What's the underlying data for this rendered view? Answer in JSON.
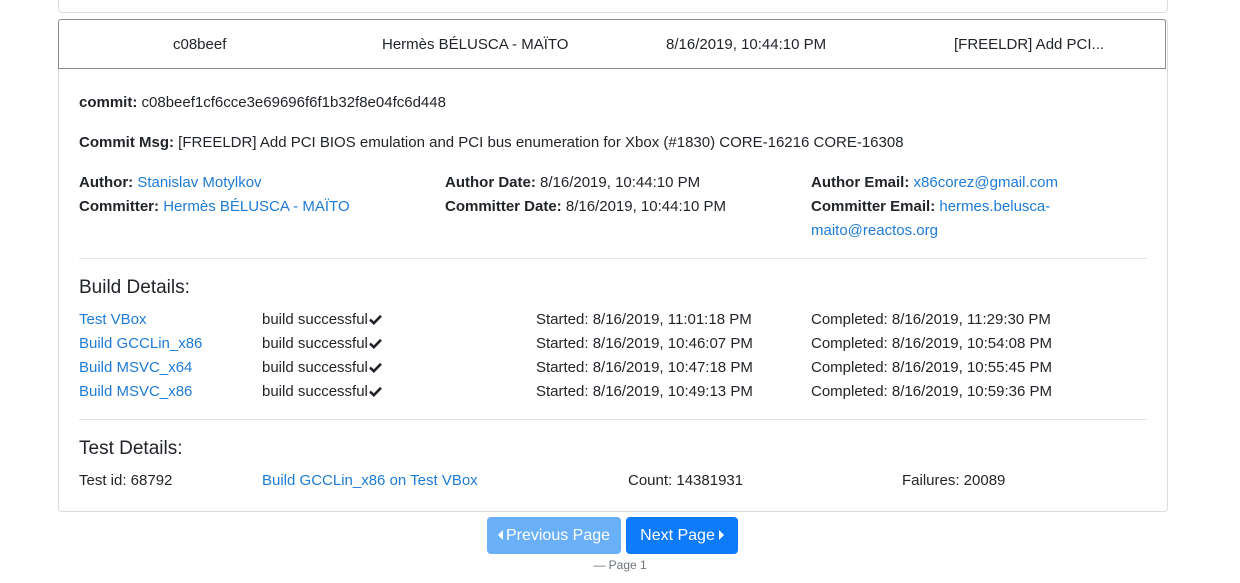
{
  "summary": {
    "sha": "c08beef",
    "author": "Hermès BÉLUSCA - MAÏTO",
    "date": "8/16/2019, 10:44:10 PM",
    "message": "[FREELDR] Add PCI..."
  },
  "details": {
    "commit_label": "commit:",
    "commit_value": "c08beef1cf6cce3e69696f6f1b32f8e04fc6d448",
    "msg_label": "Commit Msg:",
    "msg_value": "[FREELDR] Add PCI BIOS emulation and PCI bus enumeration for Xbox (#1830) CORE-16216 CORE-16308",
    "author_label": "Author:",
    "author_value": "Stanislav Motylkov",
    "committer_label": "Committer:",
    "committer_value": "Hermès BÉLUSCA - MAÏTO",
    "author_date_label": "Author Date:",
    "author_date_value": "8/16/2019, 10:44:10 PM",
    "committer_date_label": "Committer Date:",
    "committer_date_value": "8/16/2019, 10:44:10 PM",
    "author_email_label": "Author Email:",
    "author_email_value": "x86corez@gmail.com",
    "committer_email_label": "Committer Email:",
    "committer_email_line1": "hermes.belusca-",
    "committer_email_line2": "maito@reactos.org"
  },
  "build": {
    "heading": "Build Details:",
    "rows": [
      {
        "name": "Test VBox",
        "status": "build successful",
        "started": "Started: 8/16/2019, 11:01:18 PM",
        "completed": "Completed: 8/16/2019, 11:29:30 PM"
      },
      {
        "name": "Build GCCLin_x86",
        "status": "build successful",
        "started": "Started: 8/16/2019, 10:46:07 PM",
        "completed": "Completed: 8/16/2019, 10:54:08 PM"
      },
      {
        "name": "Build MSVC_x64",
        "status": "build successful",
        "started": "Started: 8/16/2019, 10:47:18 PM",
        "completed": "Completed: 8/16/2019, 10:55:45 PM"
      },
      {
        "name": "Build MSVC_x86",
        "status": "build successful",
        "started": "Started: 8/16/2019, 10:49:13 PM",
        "completed": "Completed: 8/16/2019, 10:59:36 PM"
      }
    ]
  },
  "tests": {
    "heading": "Test Details:",
    "test_id": "Test id: 68792",
    "test_name": "Build GCCLin_x86 on Test VBox",
    "count": "Count: 14381931",
    "failures": "Failures: 20089"
  },
  "pagination": {
    "prev_label": "Previous Page",
    "next_label": "Next Page",
    "page_label": "— Page 1"
  },
  "colors": {
    "link": "#1e7bd6",
    "prev_button": "#6ab0f9",
    "next_button": "#0d7bfb"
  },
  "icons": {
    "check": "check-icon",
    "prev": "caret-left-icon",
    "next": "caret-right-icon"
  }
}
